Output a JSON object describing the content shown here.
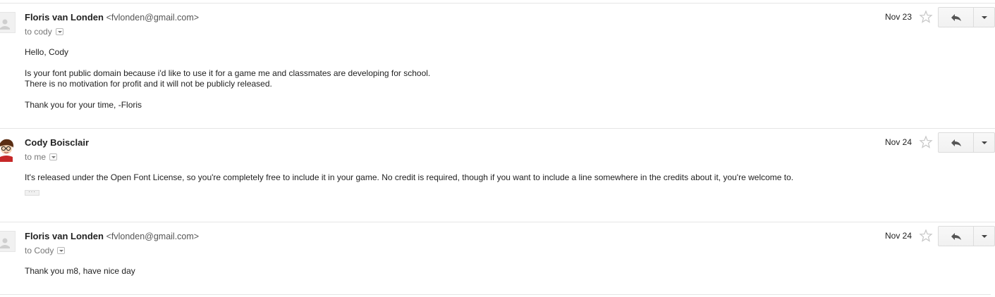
{
  "messages": [
    {
      "sender_name": "Floris van Londen",
      "sender_email": "<fvlonden@gmail.com>",
      "to": "to cody",
      "date": "Nov 23",
      "avatar_icon": "default-person-icon",
      "body": {
        "greeting": "Hello, Cody",
        "line1": "Is your font public domain because i'd like to use it for a game me and classmates are developing for school.",
        "line2": "There is no motivation for profit and it will not be publicly released.",
        "signoff": "Thank you for your time, -Floris"
      }
    },
    {
      "sender_name": "Cody Boisclair",
      "to": "to me",
      "date": "Nov 24",
      "avatar_icon": "cartoon-avatar-icon",
      "body": {
        "line1": "It's released under the Open Font License, so you're completely free to include it in your game. No credit is required, though if you want to include a line somewhere in the credits about it, you're welcome to."
      },
      "trimmed_content_label": "···"
    },
    {
      "sender_name": "Floris van Londen",
      "sender_email": "<fvlonden@gmail.com>",
      "to": "to Cody",
      "date": "Nov 24",
      "avatar_icon": "default-person-icon",
      "body": {
        "line1": "Thank you m8, have nice day"
      }
    }
  ],
  "icons": {
    "star": "star-outline-icon",
    "reply": "reply-arrow-icon",
    "more": "chevron-down-icon"
  },
  "colors": {
    "divider": "#e5e5e5",
    "text": "#222222",
    "muted": "#777777"
  }
}
